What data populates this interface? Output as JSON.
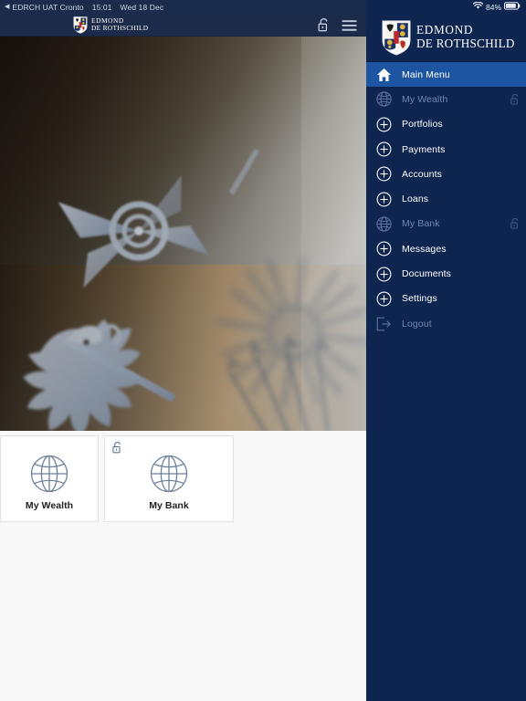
{
  "status_bar": {
    "back_caret": "◀",
    "carrier": "EDRCH UAT Cronto",
    "time": "15:01",
    "date": "Wed 18 Dec",
    "battery_percent": "84%",
    "wifi_icon": "wifi-icon",
    "battery_icon": "battery-icon"
  },
  "header": {
    "brand_line1": "EDMOND",
    "brand_line2": "DE ROTHSCHILD",
    "unlock_icon": "unlock-icon",
    "menu_icon": "hamburger-menu-icon",
    "logo_icon": "rothschild-shield-logo"
  },
  "hero": {
    "alt": "engraved-coat-of-arms-closeup",
    "colors": {
      "dark": "#241c12",
      "mid": "#6a6050",
      "light": "#c9c7c2",
      "accent": "#d79a45",
      "engraving": "#9fb0c6"
    }
  },
  "tiles": [
    {
      "id": "my-wealth",
      "label": "My Wealth",
      "icon": "globe-icon",
      "locked": false
    },
    {
      "id": "my-bank",
      "label": "My Bank",
      "icon": "globe-icon",
      "locked": true,
      "lock_icon": "unlock-icon"
    }
  ],
  "sidebar": {
    "brand_line1": "EDMOND",
    "brand_line2": "DE ROTHSCHILD",
    "logo_icon": "rothschild-shield-logo",
    "items": [
      {
        "label": "Main Menu",
        "icon": "home-icon",
        "state": "active",
        "trailing": ""
      },
      {
        "label": "My Wealth",
        "icon": "globe-icon",
        "state": "dim",
        "trailing": "unlock-icon"
      },
      {
        "label": "Portfolios",
        "icon": "plus-circle-icon",
        "state": "normal",
        "trailing": ""
      },
      {
        "label": "Payments",
        "icon": "plus-circle-icon",
        "state": "normal",
        "trailing": ""
      },
      {
        "label": "Accounts",
        "icon": "plus-circle-icon",
        "state": "normal",
        "trailing": ""
      },
      {
        "label": "Loans",
        "icon": "plus-circle-icon",
        "state": "normal",
        "trailing": ""
      },
      {
        "label": "My Bank",
        "icon": "globe-icon",
        "state": "dim",
        "trailing": "unlock-icon"
      },
      {
        "label": "Messages",
        "icon": "plus-circle-icon",
        "state": "normal",
        "trailing": ""
      },
      {
        "label": "Documents",
        "icon": "plus-circle-icon",
        "state": "normal",
        "trailing": ""
      },
      {
        "label": "Settings",
        "icon": "plus-circle-icon",
        "state": "normal",
        "trailing": ""
      },
      {
        "label": "Logout",
        "icon": "logout-icon",
        "state": "dim",
        "trailing": ""
      }
    ]
  },
  "colors": {
    "sidebar_bg": "#0e2550",
    "sidebar_active": "#1d55a3",
    "header_bg": "#1c2b4a",
    "status_bg": "#1b2b4b",
    "content_bg": "#f9f8f8",
    "tile_bg": "#ffffff",
    "tile_border": "#e2e2e2",
    "icon_blue": "#5f7796",
    "dim_text": "#6f87b4"
  }
}
